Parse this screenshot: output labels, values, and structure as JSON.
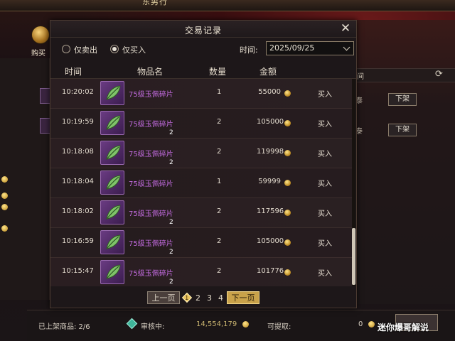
{
  "background": {
    "shop_label": "购买",
    "unlist_label": "下架",
    "unlist_rows": [
      "泰",
      "泰"
    ],
    "header_partial": "间",
    "title_partial": "东男行"
  },
  "dialog": {
    "title": "交易记录",
    "close_icon": "close-icon",
    "filters": {
      "sold_only": "仅卖出",
      "bought_only": "仅买入",
      "sold_only_checked": false,
      "bought_only_checked": true
    },
    "time_label": "时间:",
    "date_value": "2025/09/25",
    "columns": {
      "time": "时间",
      "item": "物品名",
      "qty": "数量",
      "amount": "金额"
    },
    "rows": [
      {
        "time": "10:20:02",
        "item": "75级玉佩碎片",
        "icon_count": "",
        "qty": "1",
        "amount": "55000",
        "type": "买入"
      },
      {
        "time": "10:19:59",
        "item": "75级玉佩碎片",
        "icon_count": "2",
        "qty": "2",
        "amount": "105000",
        "type": "买入"
      },
      {
        "time": "10:18:08",
        "item": "75级玉佩碎片",
        "icon_count": "2",
        "qty": "2",
        "amount": "119998",
        "type": "买入"
      },
      {
        "time": "10:18:04",
        "item": "75级玉佩碎片",
        "icon_count": "",
        "qty": "1",
        "amount": "59999",
        "type": "买入"
      },
      {
        "time": "10:18:02",
        "item": "75级玉佩碎片",
        "icon_count": "2",
        "qty": "2",
        "amount": "117596",
        "type": "买入"
      },
      {
        "time": "10:16:59",
        "item": "75级玉佩碎片",
        "icon_count": "2",
        "qty": "2",
        "amount": "105000",
        "type": "买入"
      },
      {
        "time": "10:15:47",
        "item": "75级玉佩碎片",
        "icon_count": "2",
        "qty": "2",
        "amount": "101776",
        "type": "买入"
      }
    ],
    "pager": {
      "prev": "上一页",
      "current": "1",
      "pages": [
        "2",
        "3",
        "4"
      ],
      "next": "下一页"
    }
  },
  "status_bar": {
    "listed_label": "已上架商品: 2/6",
    "review_label": "审核中:",
    "review_value": "14,554,179",
    "withdraw_label": "可提取:",
    "withdraw_value": "0"
  },
  "watermark": "迷你爆哥解说",
  "colors": {
    "item_name": "#c36be0",
    "next_button": "#c9a24a",
    "coin": "#e0b23a",
    "review_icon": "#3fb59a"
  }
}
